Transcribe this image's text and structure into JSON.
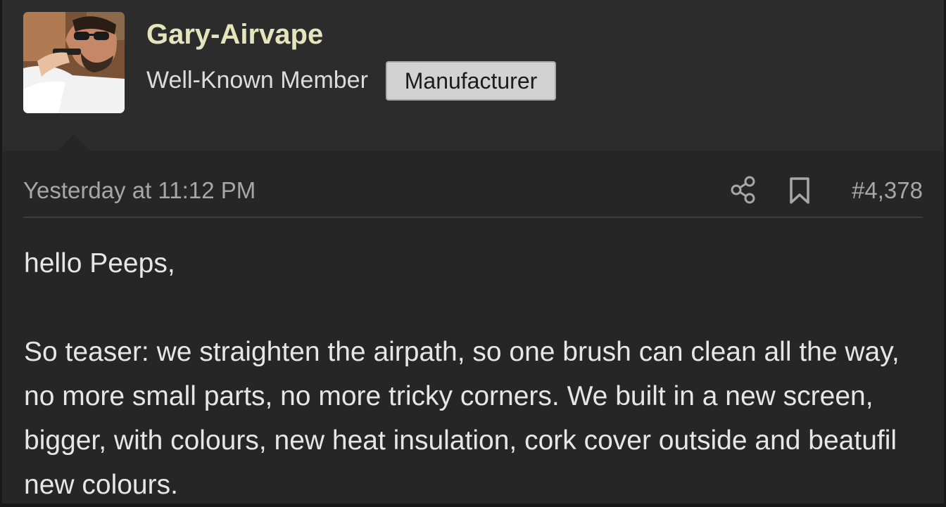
{
  "user": {
    "name": "Gary-Airvape",
    "title": "Well-Known Member",
    "badge": "Manufacturer",
    "avatar_icon": "user-avatar-photo"
  },
  "post": {
    "timestamp": "Yesterday at 11:12 PM",
    "number": "#4,378",
    "actions": {
      "share_icon": "share-icon",
      "bookmark_icon": "bookmark-icon"
    },
    "body": {
      "greeting": "hello Peeps,",
      "paragraph": "So teaser: we straighten the airpath, so one brush can clean all the way, no more small parts, no more tricky corners. We built in a new screen, bigger, with colours, new heat insulation, cork cover outside and beatufil new colours."
    }
  },
  "colors": {
    "page_background": "#262626",
    "header_background": "#2c2c2c",
    "username": "#e4e5bd",
    "badge_background": "#d2d2d2",
    "meta_text": "#a7a7a7",
    "body_text": "#e6e6e6"
  }
}
